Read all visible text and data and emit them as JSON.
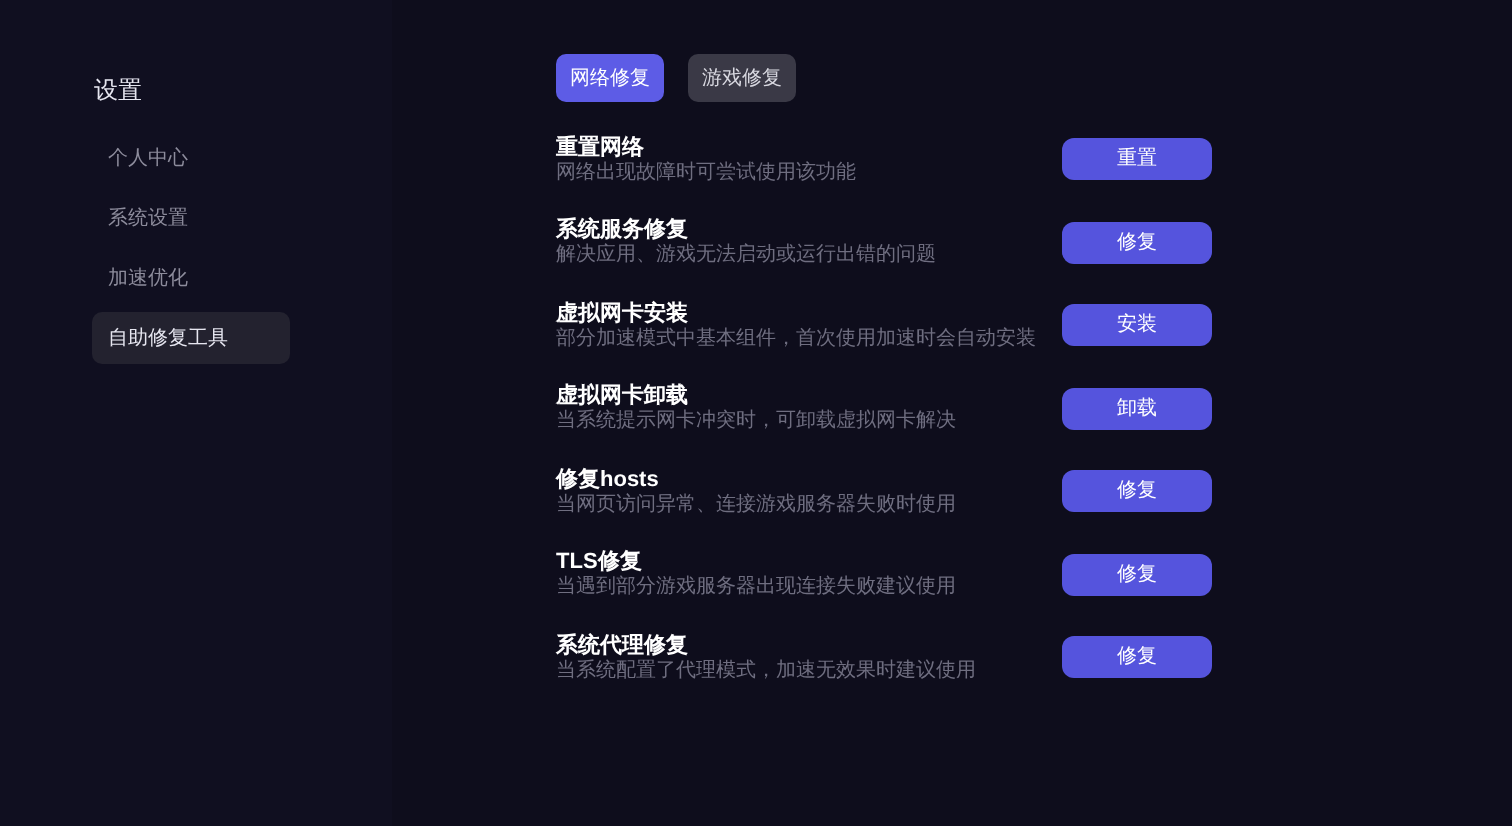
{
  "sidebar": {
    "title": "设置",
    "items": [
      {
        "label": "个人中心",
        "selected": false
      },
      {
        "label": "系统设置",
        "selected": false
      },
      {
        "label": "加速优化",
        "selected": false
      },
      {
        "label": "自助修复工具",
        "selected": true
      }
    ]
  },
  "tabs": [
    {
      "label": "网络修复",
      "selected": true
    },
    {
      "label": "游戏修复",
      "selected": false
    }
  ],
  "repairs": [
    {
      "title": "重置网络",
      "description": "网络出现故障时可尝试使用该功能",
      "button": "重置"
    },
    {
      "title": "系统服务修复",
      "description": "解决应用、游戏无法启动或运行出错的问题",
      "button": "修复"
    },
    {
      "title": "虚拟网卡安装",
      "description": "部分加速模式中基本组件，首次使用加速时会自动安装",
      "button": "安装"
    },
    {
      "title": "虚拟网卡卸载",
      "description": "当系统提示网卡冲突时，可卸载虚拟网卡解决",
      "button": "卸载"
    },
    {
      "title": "修复hosts",
      "description": "当网页访问异常、连接游戏服务器失败时使用",
      "button": "修复"
    },
    {
      "title": "TLS修复",
      "description": "当遇到部分游戏服务器出现连接失败建议使用",
      "button": "修复"
    },
    {
      "title": "系统代理修复",
      "description": "当系统配置了代理模式，加速无效果时建议使用",
      "button": "修复"
    }
  ]
}
